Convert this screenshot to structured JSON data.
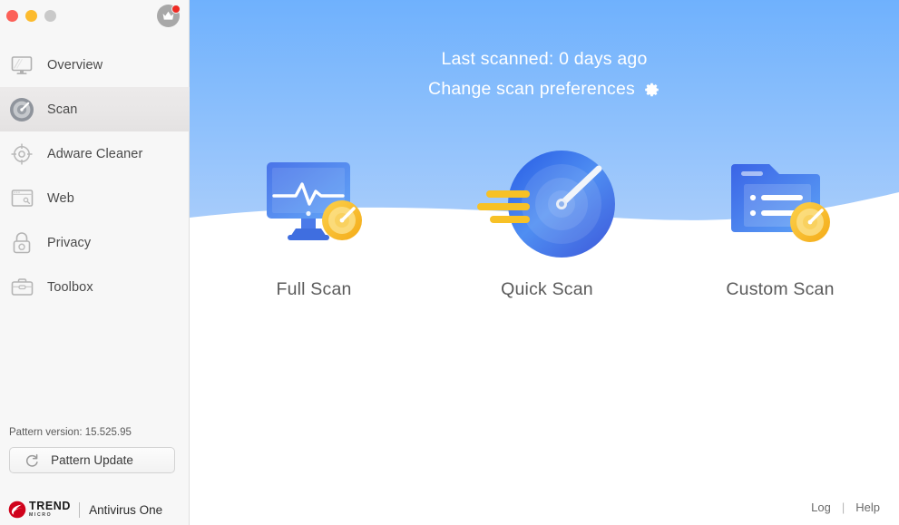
{
  "window": {
    "traffic_lights": [
      {
        "name": "close",
        "color": "#fc6058"
      },
      {
        "name": "minimize",
        "color": "#fcbb2e"
      },
      {
        "name": "zoom",
        "color": "#c9c9c9"
      }
    ],
    "crown_icon": "crown-icon",
    "crown_badge_color": "#ee2b24"
  },
  "sidebar": {
    "items": [
      {
        "label": "Overview",
        "icon": "monitor-icon",
        "active": false
      },
      {
        "label": "Scan",
        "icon": "radar-icon",
        "active": true
      },
      {
        "label": "Adware Cleaner",
        "icon": "crosshair-icon",
        "active": false
      },
      {
        "label": "Web",
        "icon": "browser-window-icon",
        "active": false
      },
      {
        "label": "Privacy",
        "icon": "padlock-icon",
        "active": false
      },
      {
        "label": "Toolbox",
        "icon": "toolbox-icon",
        "active": false
      }
    ],
    "pattern_version": "Pattern version: 15.525.95",
    "pattern_update_label": "Pattern Update",
    "pattern_update_icon": "refresh-icon",
    "brand": {
      "logo_icon": "trend-micro-logo-icon",
      "name_line1": "TREND",
      "name_line2": "MICRO",
      "product": "Antivirus One",
      "logo_color": "#d0021b"
    }
  },
  "main": {
    "hero": {
      "last_scanned": "Last scanned: 0 days ago",
      "preferences_label": "Change scan preferences",
      "preferences_icon": "gear-icon",
      "gradient_top": "#6fb1fd",
      "gradient_bottom": "#a7ccfb"
    },
    "scans": [
      {
        "label": "Full Scan",
        "icon": "monitor-pulse-scan-icon"
      },
      {
        "label": "Quick Scan",
        "icon": "radar-dial-icon"
      },
      {
        "label": "Custom Scan",
        "icon": "folder-list-scan-icon"
      }
    ],
    "footer": {
      "log_label": "Log",
      "separator": "|",
      "help_label": "Help"
    }
  }
}
